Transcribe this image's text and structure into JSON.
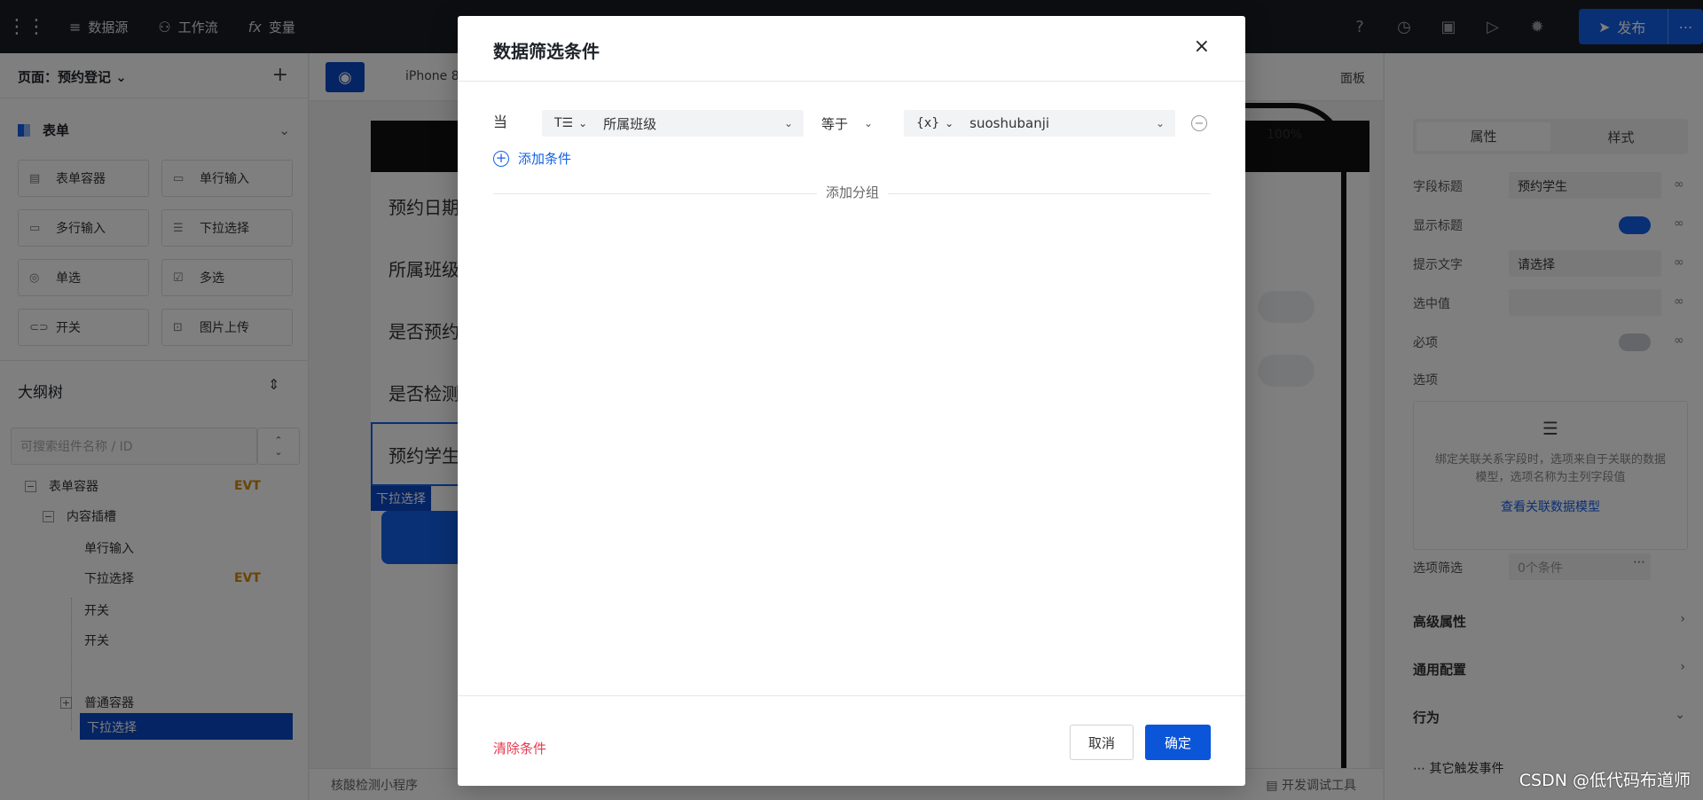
{
  "topbar": {
    "items": [
      {
        "icon": "database-icon",
        "label": "数据源"
      },
      {
        "icon": "workflow-icon",
        "label": "工作流"
      },
      {
        "icon": "function-icon",
        "label": "变量"
      }
    ],
    "publish_label": "发布"
  },
  "left": {
    "page_selector": "页面：预约登记",
    "section_title": "表单",
    "components": [
      "表单容器",
      "单行输入",
      "多行输入",
      "下拉选择",
      "单选",
      "多选",
      "开关",
      "图片上传"
    ],
    "outline_title": "大纲树",
    "search_placeholder": "可搜索组件名称 / ID",
    "tree": [
      {
        "label": "表单容器",
        "evt": "EVT"
      },
      {
        "label": "内容插槽"
      },
      {
        "label": "单行输入"
      },
      {
        "label": "下拉选择",
        "evt": "EVT"
      },
      {
        "label": "开关"
      },
      {
        "label": "开关"
      },
      {
        "label": "下拉选择"
      },
      {
        "label": "普通容器"
      }
    ]
  },
  "canvas": {
    "device": "iPhone 8",
    "panel_label": "面板",
    "battery": "100%",
    "form_labels": [
      "预约日期",
      "所属班级",
      "是否预约",
      "是否检测",
      "预约学生"
    ],
    "selected_tag": "下拉选择"
  },
  "right": {
    "tabs": [
      "属性",
      "样式"
    ],
    "field_title_label": "字段标题",
    "field_title_value": "预约学生",
    "show_title_label": "显示标题",
    "placeholder_label": "提示文字",
    "placeholder_value": "请选择",
    "selected_value_label": "选中值",
    "required_label": "必项",
    "options_label": "选项",
    "options_hint": "绑定关联关系字段时，选项来自于关联的数据模型，选项名称为主列字段值",
    "options_link": "查看关联数据模型",
    "option_filter_label": "选项筛选",
    "option_filter_value": "0个条件",
    "sections": [
      "高级属性",
      "通用配置",
      "行为"
    ],
    "other_events": "其它触发事件"
  },
  "bottom": {
    "breadcrumb": "核酸检测小程序",
    "dev_tools": "开发调试工具"
  },
  "watermark": "CSDN @低代码布道师",
  "modal": {
    "title": "数据筛选条件",
    "close": "×",
    "when": "当",
    "field_type_icon": "T☰",
    "field_value": "所属班级",
    "operator": "等于",
    "value_type_icon": "{x}",
    "value_value": "suoshubanji",
    "add_condition": "添加条件",
    "add_group": "添加分组",
    "clear": "清除条件",
    "cancel": "取消",
    "confirm": "确定"
  }
}
